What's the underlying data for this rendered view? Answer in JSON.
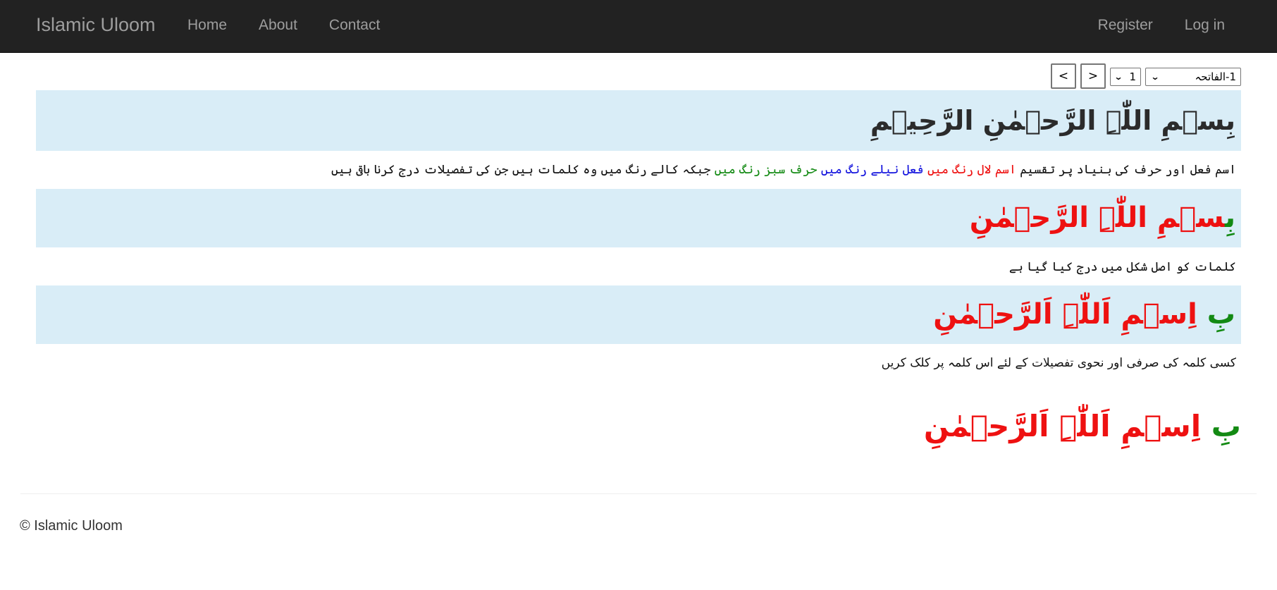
{
  "navbar": {
    "brand": "Islamic Uloom",
    "links": [
      "Home",
      "About",
      "Contact"
    ],
    "right_links": [
      "Register",
      "Log in"
    ]
  },
  "controls": {
    "surah_select": "1-الفاتحہ",
    "ayah_select": "1",
    "next_label": ">",
    "prev_label": "<"
  },
  "verse": {
    "full_text": "بِسۡمِ اللّٰہِ الرَّحۡمٰنِ الرَّحِیۡمِ",
    "legend": {
      "prefix": "اسم فعل اور حرف کی بنیاد پر تقسیم",
      "ism": "اسم لال رنگ میں",
      "fel": "فعل نیلے رنگ میں",
      "harf": "حرف سبز رنگ میں",
      "suffix": "جبکہ کالے رنگ میں وہ کلمات ہیں جن کی تفصیلات درج کرنا باقی ہیں"
    },
    "colored_1": {
      "harf": "بِ",
      "ism": "سۡمِ اللّٰہِ الرَّحۡمٰنِ"
    },
    "original_form_note": "کلمات کو اصل شکل میں درج کیا گیا ہے",
    "colored_2": {
      "harf": "بِ",
      "ism": "اِسۡمِ اَللّٰہِ اَلرَّحۡمٰنِ"
    },
    "click_note": "کسی کلمہ کی صرفی اور نحوی تفصیلات کے لئے اس کلمہ پر کلک کریں",
    "words": [
      {
        "text": "بِ",
        "type": "harf"
      },
      {
        "text": "اِسۡمِ",
        "type": "ism"
      },
      {
        "text": "اَللّٰہِ",
        "type": "ism"
      },
      {
        "text": "اَلرَّحۡمٰنِ",
        "type": "ism"
      }
    ]
  },
  "colors": {
    "ism": "#ee1111",
    "fel": "#1111dd",
    "harf": "#138a13",
    "band": "#d9edf7",
    "navbar": "#222222"
  },
  "footer": {
    "text": "© Islamic Uloom"
  }
}
